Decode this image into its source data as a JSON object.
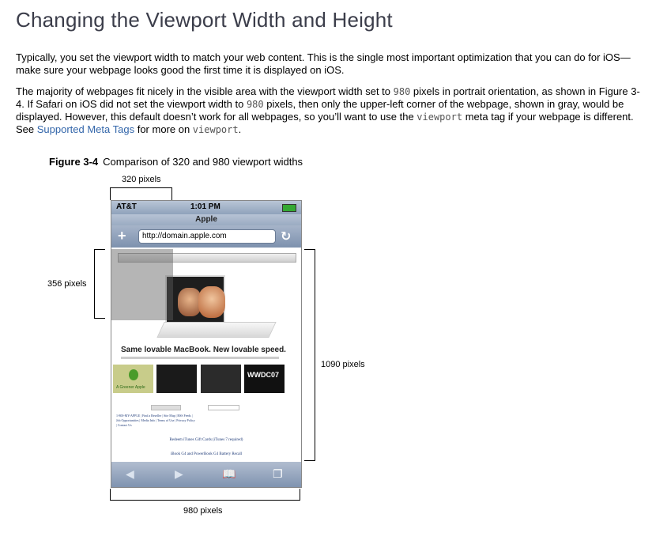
{
  "heading": "Changing the Viewport Width and Height",
  "para1": "Typically, you set the viewport width to match your web content. This is the single most important optimization that you can do for iOS—make sure your webpage looks good the first time it is displayed on iOS.",
  "para2": {
    "t1": "The majority of webpages fit nicely in the visible area with the viewport width set to ",
    "c1": "980",
    "t2": " pixels in portrait orientation, as shown in Figure 3-4. If Safari on iOS did not set the viewport width to ",
    "c2": "980",
    "t3": " pixels, then only the upper-left corner of the webpage, shown in gray, would be displayed. However, this default doesn’t work for all webpages, so you’ll want to use the ",
    "c3": "viewport",
    "t4": " meta tag if your webpage is different. See ",
    "link": "Supported Meta Tags",
    "t5": " for more on ",
    "c4": "viewport",
    "t6": "."
  },
  "figure": {
    "label": "Figure 3-4",
    "caption": "Comparison of 320 and 980 viewport widths",
    "dim_320": "320 pixels",
    "dim_356": "356 pixels",
    "dim_1090": "1090 pixels",
    "dim_980": "980 pixels"
  },
  "phone": {
    "carrier": "AT&T",
    "time": "1:01 PM",
    "page_title": "Apple",
    "url": "http://domain.apple.com",
    "tagline": "Same lovable MacBook. New lovable speed.",
    "tile_label": "A Greener Apple",
    "wwdc": "WWDC07",
    "footer_links": "1-800-MY-APPLE | Find a Reseller | Site Map | RSS Feeds | Job Opportunities | Media Info | Terms of Use | Privacy Policy | Contact Us",
    "footer2": "Redeem iTunes Gift Cards (iTunes 7 required)",
    "footer3": "iBook G4 and PowerBook G4 Battery Recall"
  }
}
